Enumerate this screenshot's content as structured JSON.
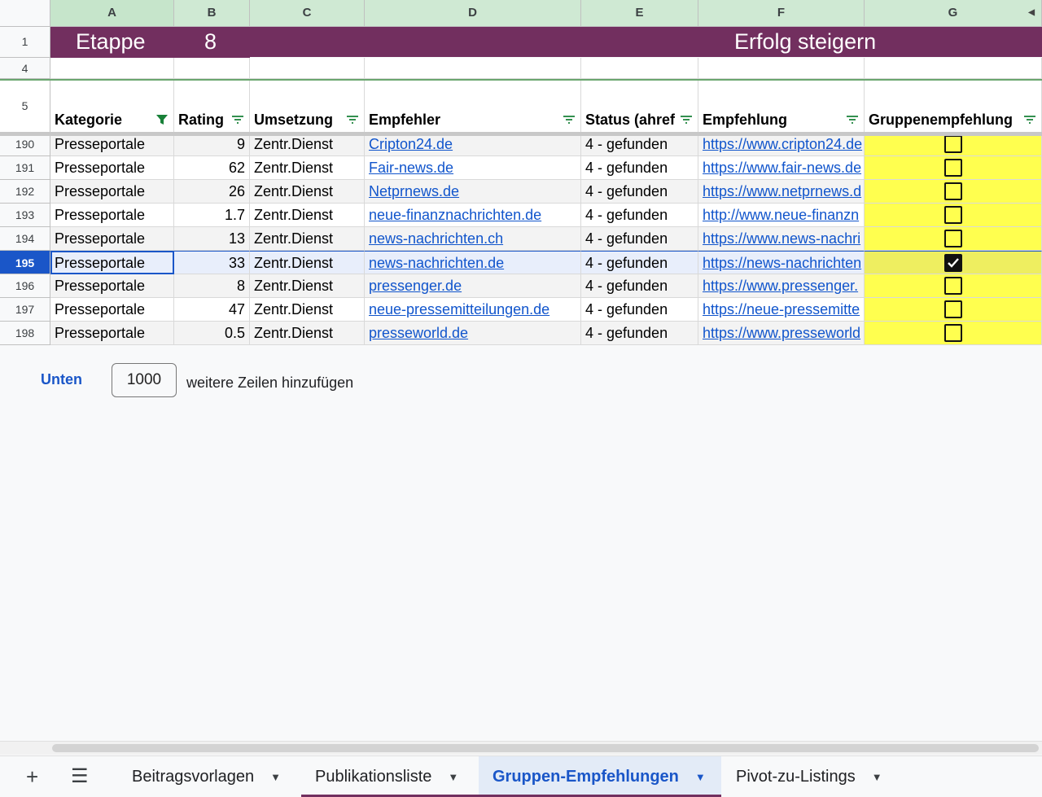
{
  "columns": [
    "A",
    "B",
    "C",
    "D",
    "E",
    "F",
    "G"
  ],
  "banner": {
    "row_label": "1",
    "stage_label": "Etappe",
    "stage_value": "8",
    "title": "Erfolg steigern"
  },
  "row4_label": "4",
  "header_row": {
    "row_label": "5",
    "kategorie": "Kategorie",
    "rating": "Rating",
    "umsetzung": "Umsetzung",
    "empfehler": "Empfehler",
    "status": "Status (ahref",
    "empfehlung": "Empfehlung",
    "gruppenempfehlung": "Gruppenempfehlung"
  },
  "rows": [
    {
      "num": "190",
      "kategorie": "Presseportale",
      "rating": "9",
      "umsetzung": "Zentr.Dienst",
      "empfehler": "Cripton24.de",
      "status": "4 - gefunden",
      "empfehlung": "https://www.cripton24.de",
      "checked": false
    },
    {
      "num": "191",
      "kategorie": "Presseportale",
      "rating": "62",
      "umsetzung": "Zentr.Dienst",
      "empfehler": "Fair-news.de",
      "status": "4 - gefunden",
      "empfehlung": "https://www.fair-news.de",
      "checked": false
    },
    {
      "num": "192",
      "kategorie": "Presseportale",
      "rating": "26",
      "umsetzung": "Zentr.Dienst",
      "empfehler": "Netprnews.de",
      "status": "4 - gefunden",
      "empfehlung": "https://www.netprnews.d",
      "checked": false
    },
    {
      "num": "193",
      "kategorie": "Presseportale",
      "rating": "1.7",
      "umsetzung": "Zentr.Dienst",
      "empfehler": "neue-finanznachrichten.de",
      "status": "4 - gefunden",
      "empfehlung": "http://www.neue-finanzn",
      "checked": false
    },
    {
      "num": "194",
      "kategorie": "Presseportale",
      "rating": "13",
      "umsetzung": "Zentr.Dienst",
      "empfehler": "news-nachrichten.ch",
      "status": "4 - gefunden",
      "empfehlung": "https://www.news-nachri",
      "checked": false
    },
    {
      "num": "195",
      "kategorie": "Presseportale",
      "rating": "33",
      "umsetzung": "Zentr.Dienst",
      "empfehler": "news-nachrichten.de",
      "status": "4 - gefunden",
      "empfehlung": "https://news-nachrichten",
      "checked": true
    },
    {
      "num": "196",
      "kategorie": "Presseportale",
      "rating": "8",
      "umsetzung": "Zentr.Dienst",
      "empfehler": "pressenger.de",
      "status": "4 - gefunden",
      "empfehlung": "https://www.pressenger.",
      "checked": false
    },
    {
      "num": "197",
      "kategorie": "Presseportale",
      "rating": "47",
      "umsetzung": "Zentr.Dienst",
      "empfehler": "neue-pressemitteilungen.de",
      "status": "4 - gefunden",
      "empfehlung": "https://neue-pressemitte",
      "checked": false
    },
    {
      "num": "198",
      "kategorie": "Presseportale",
      "rating": "0.5",
      "umsetzung": "Zentr.Dienst",
      "empfehler": "presseworld.de",
      "status": "4 - gefunden",
      "empfehlung": "https://www.presseworld",
      "checked": false
    }
  ],
  "add_rows": {
    "link": "Unten",
    "count": "1000",
    "text": "weitere Zeilen hinzufügen"
  },
  "sheet_tabs": [
    {
      "label": "Beitragsvorlagen",
      "active": false
    },
    {
      "label": "Publikationsliste",
      "active": false
    },
    {
      "label": "Gruppen-Empfehlungen",
      "active": true
    },
    {
      "label": "Pivot-zu-Listings",
      "active": false
    }
  ],
  "colors": {
    "banner": "#722f5f",
    "checkbox_col": "#ffff4f",
    "selection": "#1a56c8",
    "column_header": "#cfe9d3"
  }
}
